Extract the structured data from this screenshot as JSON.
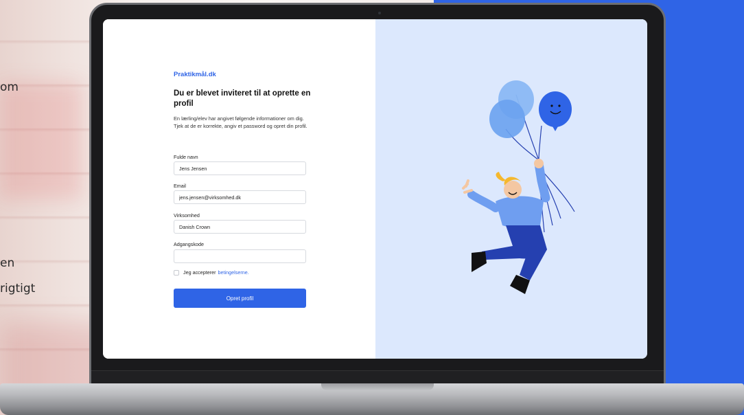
{
  "background": {
    "text_lines": [
      "om",
      "en",
      "rigtigt"
    ],
    "colors": {
      "right_panel": "#2f64e6"
    }
  },
  "form": {
    "brand": "Praktikmål.dk",
    "title": "Du er blevet inviteret til at oprette en profil",
    "description": "En lærling/elev har angivet følgende informationer om dig. Tjek at de er korrekte, angiv et password og opret din profil.",
    "fields": [
      {
        "label": "Fulde navn",
        "value": "Jens Jensen"
      },
      {
        "label": "Email",
        "value": "jens.jensen@virksomhed.dk"
      },
      {
        "label": "Virksomhed",
        "value": "Danish Crown"
      },
      {
        "label": "Adgangskode",
        "value": ""
      }
    ],
    "terms_text": "Jeg accepterer",
    "terms_link": "betingelserne.",
    "terms_checked": false,
    "submit_label": "Opret profil"
  },
  "illustration": {
    "description_icon": "person-with-balloons-icon",
    "colors": {
      "balloon_dark": "#2f64e6",
      "balloon_light": "#7fb0f5",
      "hair": "#f5b82e",
      "pants": "#2540b0",
      "shirt": "#6f9ef0"
    }
  },
  "colors": {
    "accent": "#2f64e6",
    "illustration_bg": "#dce8fd"
  }
}
